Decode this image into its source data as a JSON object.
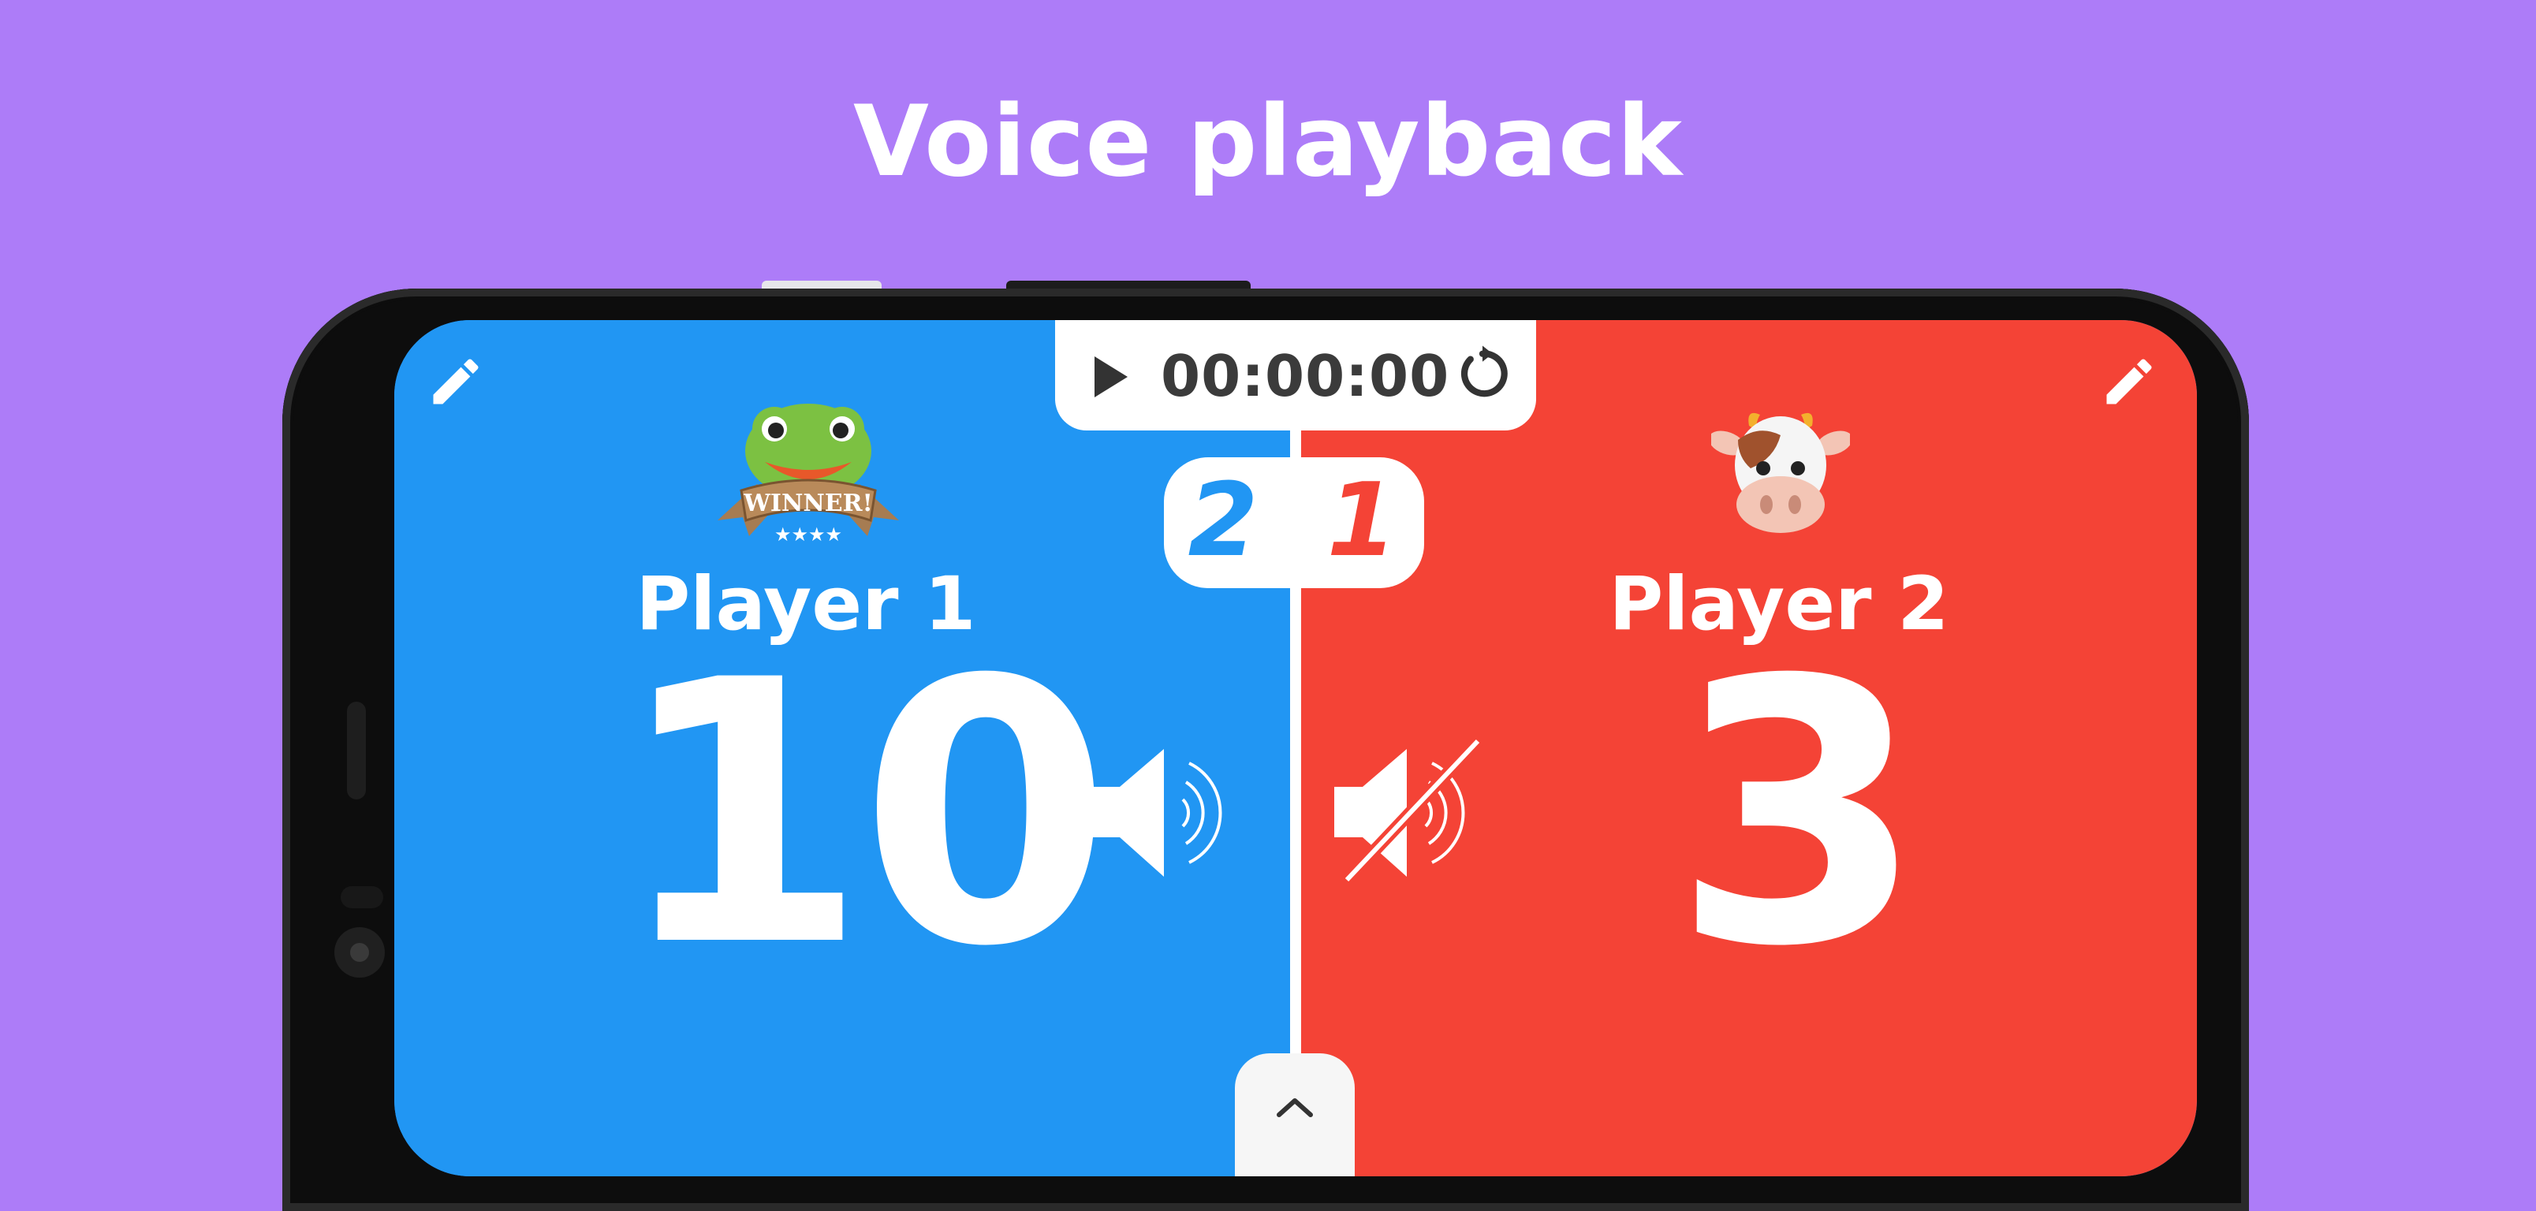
{
  "headline": "Voice playback",
  "timer": {
    "time": "00:00:00",
    "play_icon": "play-icon",
    "reset_icon": "reset-icon"
  },
  "rounds": {
    "player1_wins": "2",
    "player2_wins": "1"
  },
  "player1": {
    "name": "Player 1",
    "score": "10",
    "avatar": "frog-winner-avatar",
    "badge_text": "WINNER!",
    "voice": "speaker-on",
    "color": "#2196f3"
  },
  "player2": {
    "name": "Player 2",
    "score": "3",
    "avatar": "cow-avatar",
    "voice": "speaker-muted",
    "color": "#f44336"
  },
  "colors": {
    "background": "#ad7cf8",
    "player1": "#2196f3",
    "player2": "#f44336"
  }
}
